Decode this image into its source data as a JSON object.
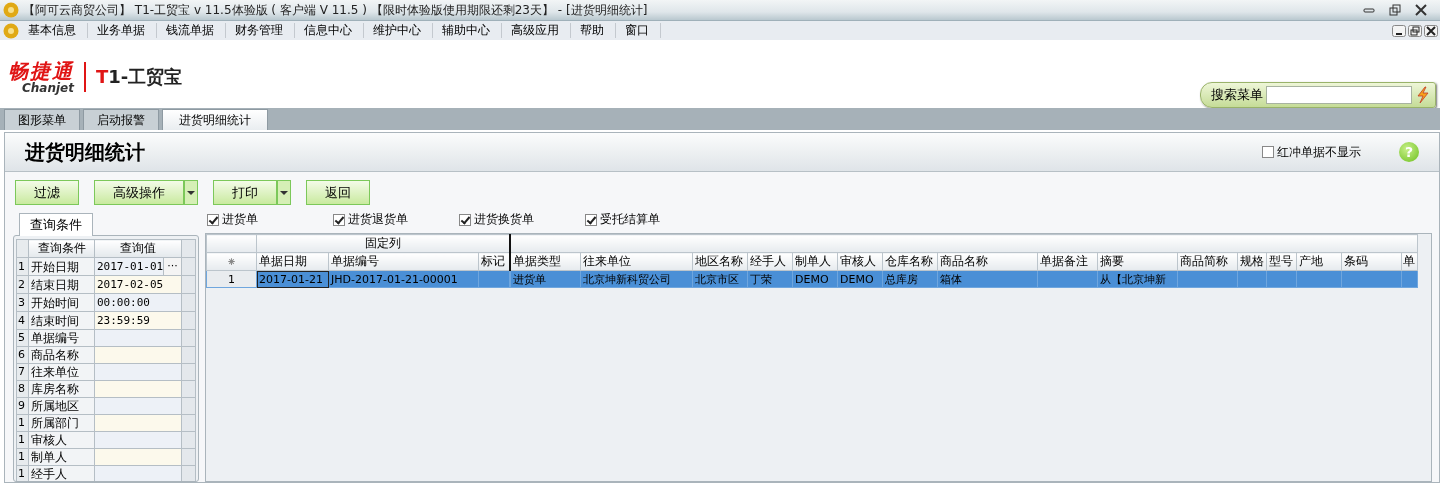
{
  "window": {
    "title": "【阿可云商贸公司】 T1-工贸宝 v 11.5体验版 ( 客户端 V 11.5 ) 【限时体验版使用期限还剩23天】 - [进货明细统计]"
  },
  "menu_bar": {
    "items": [
      "基本信息",
      "业务单据",
      "钱流单据",
      "财务管理",
      "信息中心",
      "维护中心",
      "辅助中心",
      "高级应用",
      "帮助",
      "窗口"
    ]
  },
  "logo": {
    "brand": "畅捷通",
    "brand_latin": "Chanjet",
    "product": "T1-工贸宝"
  },
  "search": {
    "label": "搜索菜单"
  },
  "tabs": [
    {
      "label": "图形菜单",
      "selected": false
    },
    {
      "label": "启动报警",
      "selected": false
    },
    {
      "label": "进货明细统计",
      "selected": true
    }
  ],
  "page": {
    "title": "进货明细统计",
    "hide_red_option": {
      "label": "红冲单据不显示",
      "checked": false
    },
    "help": "?"
  },
  "toolbar": [
    {
      "label": "过滤",
      "kind": "plain"
    },
    {
      "label": "高级操作",
      "kind": "dropdown"
    },
    {
      "label": "打印",
      "kind": "dropdown"
    },
    {
      "label": "返回",
      "kind": "plain"
    }
  ],
  "filters": [
    {
      "label": "进货单",
      "checked": true
    },
    {
      "label": "进货退货单",
      "checked": true
    },
    {
      "label": "进货换货单",
      "checked": true
    },
    {
      "label": "受托结算单",
      "checked": true
    }
  ],
  "query_panel": {
    "tab": "查询条件",
    "columns": [
      "查询条件",
      "查询值"
    ],
    "rows": [
      {
        "index": "1",
        "name": "开始日期",
        "value": "2017-01-01",
        "button": "···"
      },
      {
        "index": "2",
        "name": "结束日期",
        "value": "2017-02-05"
      },
      {
        "index": "3",
        "name": "开始时间",
        "value": "00:00:00"
      },
      {
        "index": "4",
        "name": "结束时间",
        "value": "23:59:59"
      },
      {
        "index": "5",
        "name": "单据编号"
      },
      {
        "index": "6",
        "name": "商品名称"
      },
      {
        "index": "7",
        "name": "往来单位"
      },
      {
        "index": "8",
        "name": "库房名称"
      },
      {
        "index": "9",
        "name": "所属地区"
      },
      {
        "index": "1",
        "name": "所属部门"
      },
      {
        "index": "1",
        "name": "审核人"
      },
      {
        "index": "1",
        "name": "制单人"
      },
      {
        "index": "1",
        "name": "经手人"
      }
    ]
  },
  "grid": {
    "corner": "⁕",
    "column_groups": [
      {
        "label": "固定列",
        "columns": [
          "单据日期",
          "单据编号",
          "标记"
        ]
      },
      {
        "columns": [
          "单据类型",
          "往来单位",
          "地区名称",
          "经手人",
          "制单人",
          "审核人",
          "仓库名称",
          "商品名称",
          "单据备注",
          "摘要",
          "商品简称",
          "规格",
          "型号",
          "产地",
          "条码",
          "单"
        ]
      }
    ],
    "rows": [
      {
        "index": "1",
        "selected": true,
        "cells": [
          "2017-01-21",
          "JHD-2017-01-21-00001",
          "",
          "进货单",
          "北京坤新科贸公司",
          "北京市区",
          "丁荣",
          "DEMO",
          "DEMO",
          "总库房",
          "箱体",
          "",
          "从【北京坤新",
          "",
          "",
          "",
          "",
          "",
          ""
        ]
      }
    ]
  }
}
